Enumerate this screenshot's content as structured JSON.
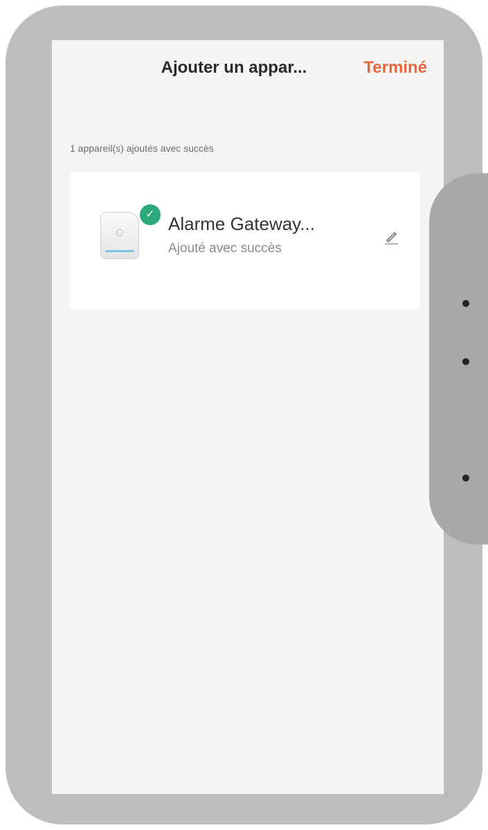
{
  "header": {
    "title": "Ajouter un appar...",
    "done_label": "Terminé"
  },
  "summary": {
    "text": "1 appareil(s) ajoutés avec succès"
  },
  "device": {
    "name": "Alarme Gateway...",
    "status": "Ajouté avec succès",
    "status_icon": "check-icon",
    "edit_icon": "pencil-icon"
  },
  "colors": {
    "accent": "#e8663c",
    "success": "#2ba97a"
  }
}
